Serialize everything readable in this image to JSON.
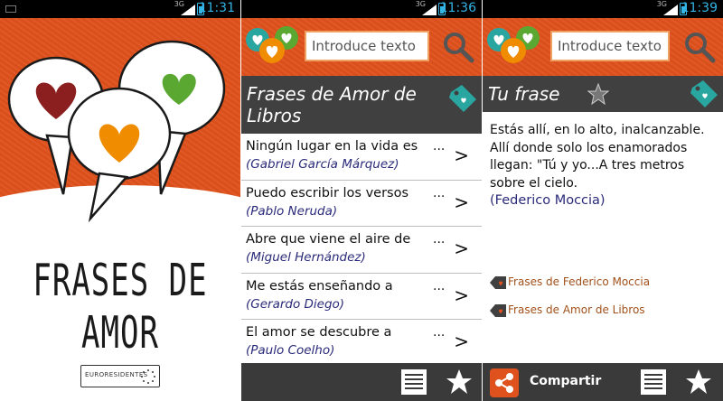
{
  "statusbar": [
    {
      "time": "11:31"
    },
    {
      "time": "11:36"
    },
    {
      "time": "11:39"
    }
  ],
  "network_label": "3G",
  "splash": {
    "title": "FRASES DE AMOR",
    "brand": "EURORESIDENTES"
  },
  "search": {
    "placeholder": "Introduce texto"
  },
  "list_screen": {
    "title": "Frases de Amor de Libros",
    "items": [
      {
        "phrase": "Ningún lugar en la vida es",
        "author": "(Gabriel García Márquez)"
      },
      {
        "phrase": "Puedo escribir los versos",
        "author": "(Pablo Neruda)"
      },
      {
        "phrase": "Abre que viene el aire de",
        "author": "(Miguel Hernández)"
      },
      {
        "phrase": "Me estás enseñando a",
        "author": "(Gerardo Diego)"
      },
      {
        "phrase": "El amor se descubre a",
        "author": "(Paulo Coelho)"
      }
    ],
    "ellipsis": "...",
    "chevron": ">"
  },
  "detail_screen": {
    "title": "Tu frase",
    "quote": "Estás allí, en lo alto, inalcanzable. Allí donde solo los enamorados llegan: \"Tú y yo...A tres metros sobre el cielo.",
    "author": "(Federico Moccia)",
    "related": [
      {
        "label": "Frases de Federico Moccia"
      },
      {
        "label": "Frases de Amor de Libros"
      }
    ],
    "share_label": "Compartir"
  },
  "colors": {
    "accent": "#e0521d",
    "dark_bar": "#404040",
    "status_blue": "#33b5e5",
    "author_text": "#2a2a7a",
    "link_text": "#a0501a",
    "heart_red": "#8b1e1e",
    "heart_orange": "#f08c00",
    "heart_green": "#5aa832",
    "tag_teal": "#2aa6a0"
  },
  "icons": {
    "search": "magnifier-icon",
    "tag": "price-tag-icon",
    "star": "star-icon",
    "list": "list-icon",
    "share": "share-icon"
  }
}
